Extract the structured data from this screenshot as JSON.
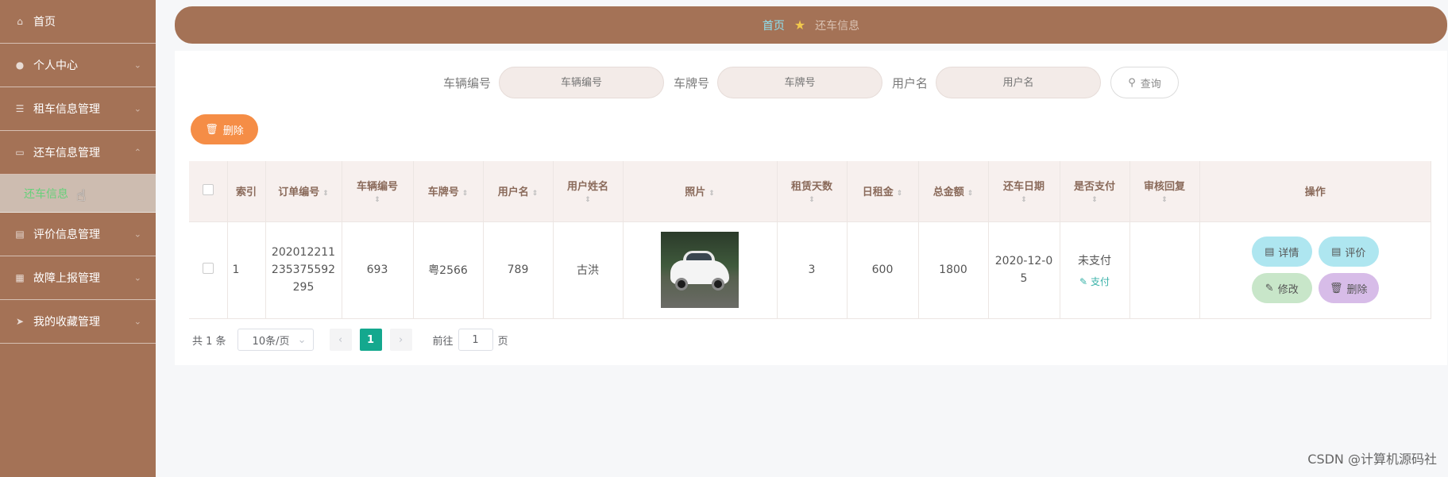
{
  "sidebar": {
    "items": [
      {
        "label": "首页",
        "icon": "home-icon",
        "has_arrow": false
      },
      {
        "label": "个人中心",
        "icon": "user-icon",
        "has_arrow": true
      },
      {
        "label": "租车信息管理",
        "icon": "sliders-icon",
        "has_arrow": true
      },
      {
        "label": "还车信息管理",
        "icon": "video-icon",
        "has_arrow": true,
        "expanded": true
      },
      {
        "label": "评价信息管理",
        "icon": "clipboard-icon",
        "has_arrow": true
      },
      {
        "label": "故障上报管理",
        "icon": "grid-icon",
        "has_arrow": true
      },
      {
        "label": "我的收藏管理",
        "icon": "send-icon",
        "has_arrow": true
      }
    ],
    "active_sub": "还车信息"
  },
  "breadcrumb": {
    "home": "首页",
    "current": "还车信息"
  },
  "search": {
    "vehicle_no_label": "车辆编号",
    "vehicle_no_placeholder": "车辆编号",
    "plate_label": "车牌号",
    "plate_placeholder": "车牌号",
    "username_label": "用户名",
    "username_placeholder": "用户名",
    "button": "查询"
  },
  "toolbar": {
    "delete_label": "删除"
  },
  "table": {
    "headers": {
      "index": "索引",
      "order_no": "订单编号",
      "vehicle_no": "车辆编号",
      "plate": "车牌号",
      "username": "用户名",
      "real_name": "用户姓名",
      "photo": "照片",
      "days": "租赁天数",
      "daily_rent": "日租金",
      "total": "总金额",
      "return_date": "还车日期",
      "paid": "是否支付",
      "review_reply": "审核回复",
      "actions": "操作"
    },
    "rows": [
      {
        "index": "1",
        "order_no": "202012211235375592295",
        "vehicle_no": "693",
        "plate": "粤2566",
        "username": "789",
        "real_name": "古洪",
        "days": "3",
        "daily_rent": "600",
        "total": "1800",
        "return_date": "2020-12-05",
        "paid": "未支付",
        "pay_link": "支付",
        "review_reply": "",
        "actions": {
          "detail": "详情",
          "rate": "评价",
          "edit": "修改",
          "delete": "删除"
        }
      }
    ]
  },
  "pagination": {
    "total": "共 1 条",
    "page_size": "10条/页",
    "current_page": "1",
    "goto_prefix": "前往",
    "goto_value": "1",
    "goto_suffix": "页"
  },
  "watermark": "CSDN @计算机源码社",
  "colors": {
    "sidebar": "#a47256",
    "accent_orange": "#f58d46",
    "page_active": "#14a88e",
    "active_sub": "#66d17a"
  }
}
